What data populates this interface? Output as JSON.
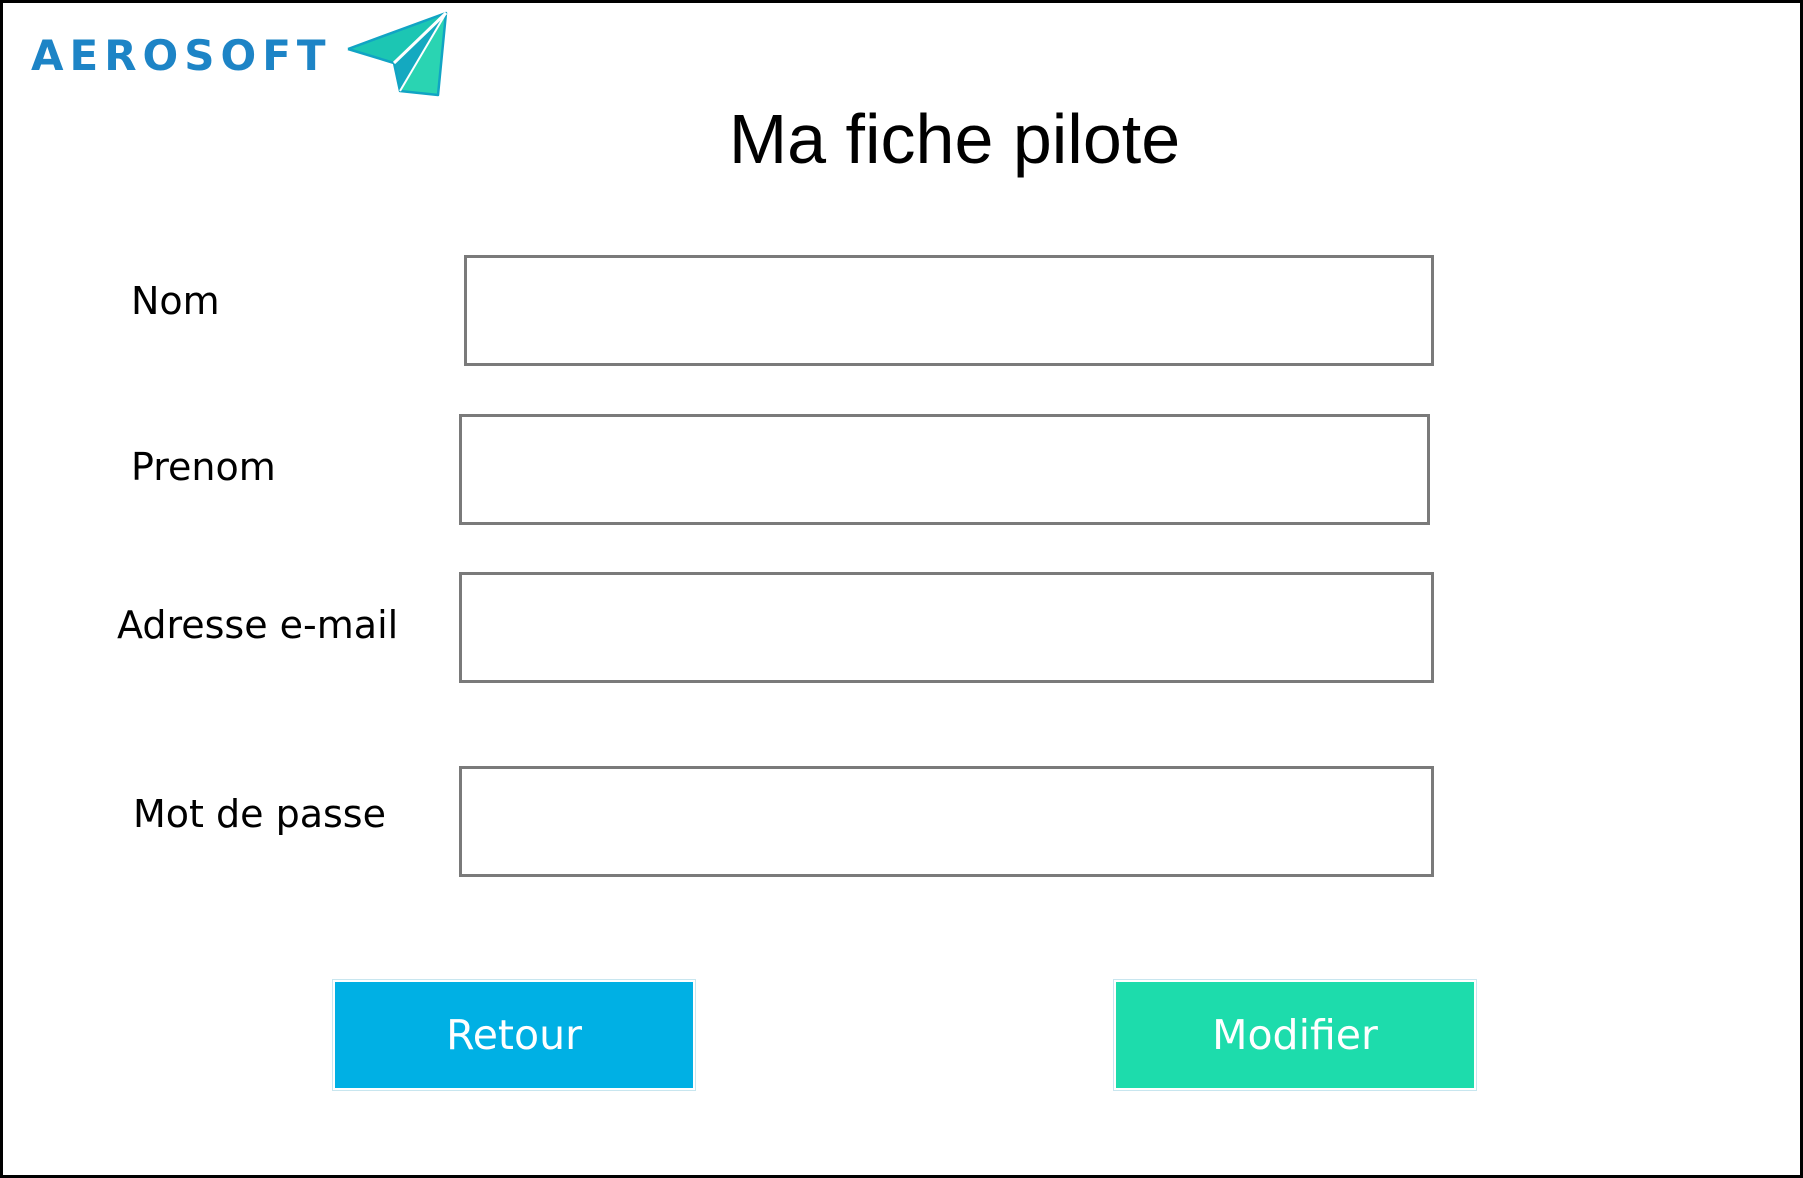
{
  "brand": {
    "name": "AEROSOFT",
    "text_color": "#1d84c6",
    "icon": "paper-plane-icon",
    "icon_color": "#1cc6b3"
  },
  "page": {
    "title": "Ma fiche pilote"
  },
  "form": {
    "fields": [
      {
        "label": "Nom",
        "value": "",
        "placeholder": ""
      },
      {
        "label": "Prenom",
        "value": "",
        "placeholder": ""
      },
      {
        "label": "Adresse e-mail",
        "value": "",
        "placeholder": ""
      },
      {
        "label": "Mot de passe",
        "value": "",
        "placeholder": ""
      }
    ]
  },
  "actions": {
    "back_label": "Retour",
    "back_color": "#00b0e4",
    "edit_label": "Modifier",
    "edit_color": "#1ddcac"
  }
}
